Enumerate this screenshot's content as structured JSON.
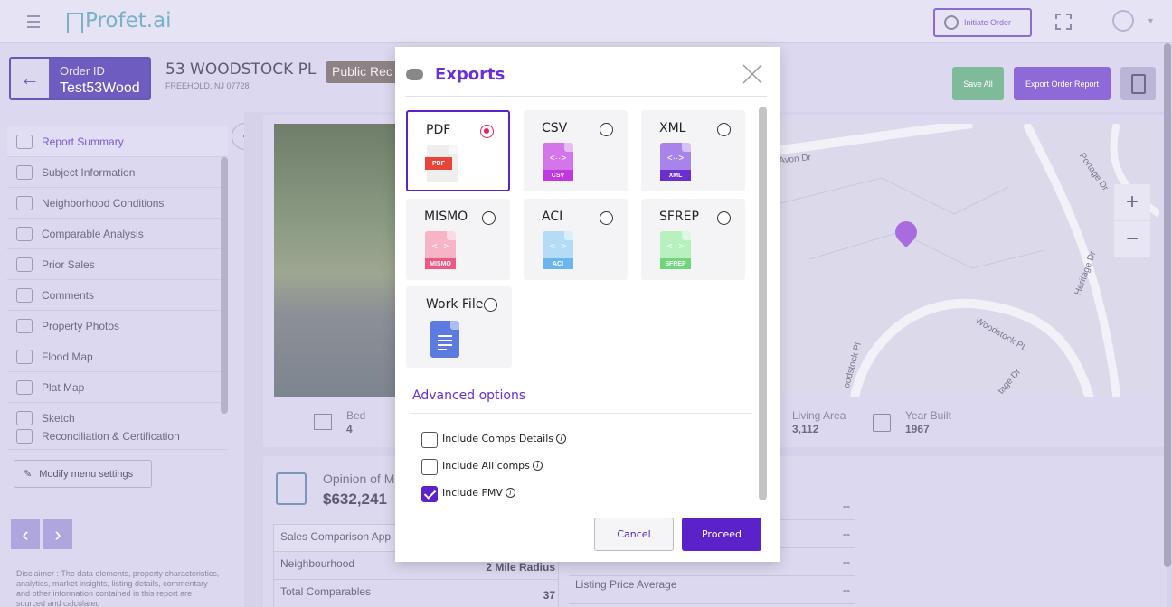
{
  "app": {
    "logo": "Profet.ai",
    "initiate_order": "Initiate Order"
  },
  "order": {
    "id_label": "Order ID",
    "id_value": "Test53Wood",
    "address": "53 WOODSTOCK PL",
    "city": "FREEHOLD, NJ 07728",
    "badge": "Public Rec",
    "save_all": "Save All",
    "export_report": "Export Order Report"
  },
  "sidebar": {
    "items": [
      {
        "label": "Report Summary"
      },
      {
        "label": "Subject Information"
      },
      {
        "label": "Neighborhood Conditions"
      },
      {
        "label": "Comparable Analysis"
      },
      {
        "label": "Prior Sales"
      },
      {
        "label": "Comments"
      },
      {
        "label": "Property Photos"
      },
      {
        "label": "Flood Map"
      },
      {
        "label": "Plat Map"
      },
      {
        "label": "Sketch"
      },
      {
        "label": "Reconciliation & Certification"
      }
    ],
    "modify_menu": "Modify menu settings",
    "disclaimer": "Disclaimer : The data elements, property characteristics, analytics, market insights, listing details, commentary and other information contained in this report are sourced and calculated"
  },
  "property": {
    "bed_label": "Bed",
    "bed_value": "4",
    "living_area_label": "Living Area",
    "living_area_value": "3,112",
    "year_built_label": "Year Built",
    "year_built_value": "1967"
  },
  "opinion": {
    "label": "Opinion of M",
    "value": "$632,241"
  },
  "rows_left": [
    {
      "label": "Sales Comparison App",
      "value": ""
    },
    {
      "label": "Neighbourhood",
      "value": "2 Mile Radius"
    },
    {
      "label": "Total Comparables",
      "value": "37"
    }
  ],
  "rows_right": [
    {
      "label": "",
      "value": "--"
    },
    {
      "label": "",
      "value": "--"
    },
    {
      "label": "",
      "value": "--"
    },
    {
      "label": "Listing Price Average",
      "value": "--"
    }
  ],
  "map_labels": {
    "avon": "Avon Dr",
    "portage": "Portage Dr",
    "heritage": "Heritage Dr",
    "woodstock": "Woodstock PL",
    "woodstock2": "oodstock Pl",
    "tage": "tage Dr"
  },
  "modal": {
    "title": "Exports",
    "formats": [
      {
        "label": "PDF",
        "tag": "PDF",
        "color": "#e8443a",
        "selected": true
      },
      {
        "label": "CSV",
        "tag": "CSV",
        "color": "#c238e0",
        "selected": false
      },
      {
        "label": "XML",
        "tag": "XML",
        "color": "#8a4de0",
        "selected": false
      },
      {
        "label": "MISMO",
        "tag": "MISMO",
        "color": "#f07a9a",
        "selected": false
      },
      {
        "label": "ACI",
        "tag": "ACI",
        "color": "#6cb6f0",
        "selected": false
      },
      {
        "label": "SFREP",
        "tag": "SFREP",
        "color": "#7ee08a",
        "selected": false
      },
      {
        "label": "Work File",
        "tag": "",
        "color": "#5b7be0",
        "selected": false
      }
    ],
    "advanced_title": "Advanced options",
    "options": [
      {
        "label": "Include Comps Details",
        "checked": false
      },
      {
        "label": "Include All comps",
        "checked": false
      },
      {
        "label": "Include FMV",
        "checked": true
      }
    ],
    "cancel": "Cancel",
    "proceed": "Proceed"
  },
  "colors": {
    "accent": "#5b22c9",
    "title": "#6a2fd6"
  }
}
